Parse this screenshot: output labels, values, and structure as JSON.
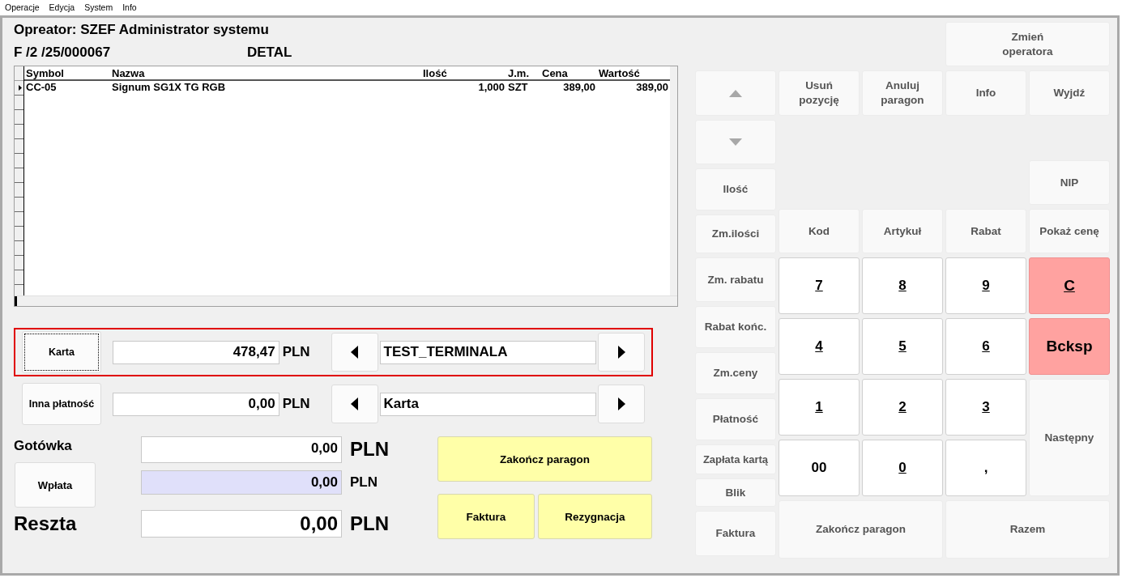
{
  "menu": [
    {
      "label": "Operacje"
    },
    {
      "label": "Edycja"
    },
    {
      "label": "System"
    },
    {
      "label": "Info"
    }
  ],
  "header": {
    "operator": "Opreator: SZEF Administrator systemu",
    "document_number": "F /2  /25/000067",
    "price_type": "DETAL"
  },
  "table": {
    "columns": [
      "Symbol",
      "Nazwa",
      "Ilość",
      "J.m.",
      "Cena",
      "Wartość"
    ],
    "rows": [
      {
        "selected": true,
        "cells": [
          "CC-05",
          "Signum SG1X TG RGB",
          "1,000",
          "SZT",
          "389,00",
          "389,00"
        ]
      }
    ]
  },
  "payments": [
    {
      "button": "Karta",
      "amount": "478,47",
      "currency": "PLN",
      "method": "TEST_TERMINALA",
      "selected": true
    },
    {
      "button": "Inna płatność",
      "amount": "0,00",
      "currency": "PLN",
      "method": "Karta",
      "selected": false
    }
  ],
  "cash": {
    "label": "Gotówka",
    "amount": "0,00",
    "currency": "PLN"
  },
  "deposit": {
    "button": "Wpłata",
    "amount": "0,00",
    "currency": "PLN"
  },
  "change": {
    "label": "Reszta",
    "amount": "0,00",
    "currency": "PLN"
  },
  "action_buttons": [
    "Zakończ paragon",
    "Faktura",
    "Rezygnacja"
  ],
  "side_buttons": [
    {
      "kind": "up"
    },
    {
      "kind": "down"
    },
    {
      "kind": "text",
      "label": "Ilość"
    },
    {
      "kind": "text",
      "label": "Zm.ilości"
    },
    {
      "kind": "text",
      "label": "Zm. rabatu"
    },
    {
      "kind": "text",
      "label": "Rabat końc."
    },
    {
      "kind": "text",
      "label": "Zm.ceny"
    },
    {
      "kind": "text",
      "label": "Płatność"
    },
    {
      "kind": "text",
      "label": "Zapłata kartą"
    },
    {
      "kind": "text",
      "label": "Blik"
    },
    {
      "kind": "text",
      "label": "Faktura"
    }
  ],
  "keypad": [
    {
      "kind": "function",
      "label": "Zmień\noperatora"
    },
    {
      "kind": "function",
      "label": "Usuń\npozycję"
    },
    {
      "kind": "function",
      "label": "Anuluj\nparagon"
    },
    {
      "kind": "function",
      "label": "Info"
    },
    {
      "kind": "function",
      "label": "Wyjdź"
    },
    {
      "kind": "function",
      "label": "NIP"
    },
    {
      "kind": "function",
      "label": "Kod"
    },
    {
      "kind": "function",
      "label": "Artykuł"
    },
    {
      "kind": "function",
      "label": "Rabat"
    },
    {
      "kind": "function",
      "label": "Pokaż cenę"
    },
    {
      "kind": "digit",
      "label": "7",
      "underlined": true
    },
    {
      "kind": "digit",
      "label": "8",
      "underlined": true
    },
    {
      "kind": "digit",
      "label": "9",
      "underlined": true
    },
    {
      "kind": "clear",
      "label": "C",
      "underlined": true
    },
    {
      "kind": "digit",
      "label": "4",
      "underlined": true
    },
    {
      "kind": "digit",
      "label": "5",
      "underlined": true
    },
    {
      "kind": "digit",
      "label": "6",
      "underlined": true
    },
    {
      "kind": "clear",
      "label": "Bcksp",
      "underlined": false
    },
    {
      "kind": "digit",
      "label": "1",
      "underlined": true
    },
    {
      "kind": "digit",
      "label": "2",
      "underlined": true
    },
    {
      "kind": "digit",
      "label": "3",
      "underlined": true
    },
    {
      "kind": "function",
      "label": "Następny"
    },
    {
      "kind": "digit",
      "label": "00",
      "underlined": false
    },
    {
      "kind": "digit",
      "label": "0",
      "underlined": true
    },
    {
      "kind": "digit",
      "label": ","
    },
    {
      "kind": "function",
      "label": "Zakończ paragon"
    },
    {
      "kind": "function",
      "label": "Razem"
    }
  ]
}
